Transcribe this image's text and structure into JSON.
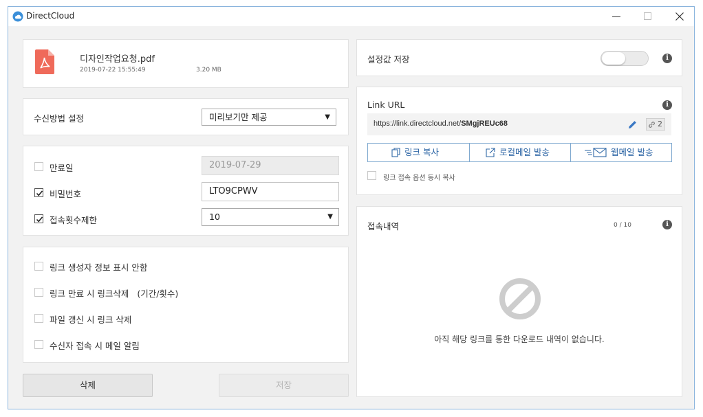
{
  "window": {
    "title": "DirectCloud"
  },
  "file": {
    "name": "디자인작업요청.pdf",
    "date": "2019-07-22 15:55:49",
    "size": "3.20 MB",
    "icon": "pdf-file-icon"
  },
  "receive": {
    "label": "수신방법 설정",
    "value": "미리보기만 제공"
  },
  "expiry": {
    "label": "만료일",
    "value": "2019-07-29",
    "checked": false
  },
  "password": {
    "label": "비밀번호",
    "value": "LTO9CPWV",
    "checked": true
  },
  "access_limit": {
    "label": "접속횟수제한",
    "value": "10",
    "checked": true
  },
  "options": [
    {
      "label": "링크 생성자 정보 표시 안함",
      "checked": false
    },
    {
      "label": "링크 만료 시 링크삭제   (기간/횟수)",
      "checked": false
    },
    {
      "label": "파일 갱신 시 링크 삭제",
      "checked": false
    },
    {
      "label": "수신자 접속 시 메일 알림",
      "checked": false
    }
  ],
  "buttons": {
    "delete": "삭제",
    "save": "저장"
  },
  "save_settings": {
    "label": "설정값 저장",
    "toggle_on": false
  },
  "link": {
    "title": "Link URL",
    "url_prefix": "https://link.directcloud.net/",
    "url_code": "SMgjREUc68",
    "count": "2",
    "copy": "링크 복사",
    "local_mail": "로컬메일 발송",
    "web_mail": "웹메일 발송",
    "copy_option": "링크 접속 옵션 동시 복사"
  },
  "history": {
    "title": "접속내역",
    "count": "0 / 10",
    "empty": "아직 해당 링크를 통한 다운로드 내역이 없습니다."
  },
  "colors": {
    "accent": "#2f67a6",
    "pdf": "#e8564a"
  }
}
